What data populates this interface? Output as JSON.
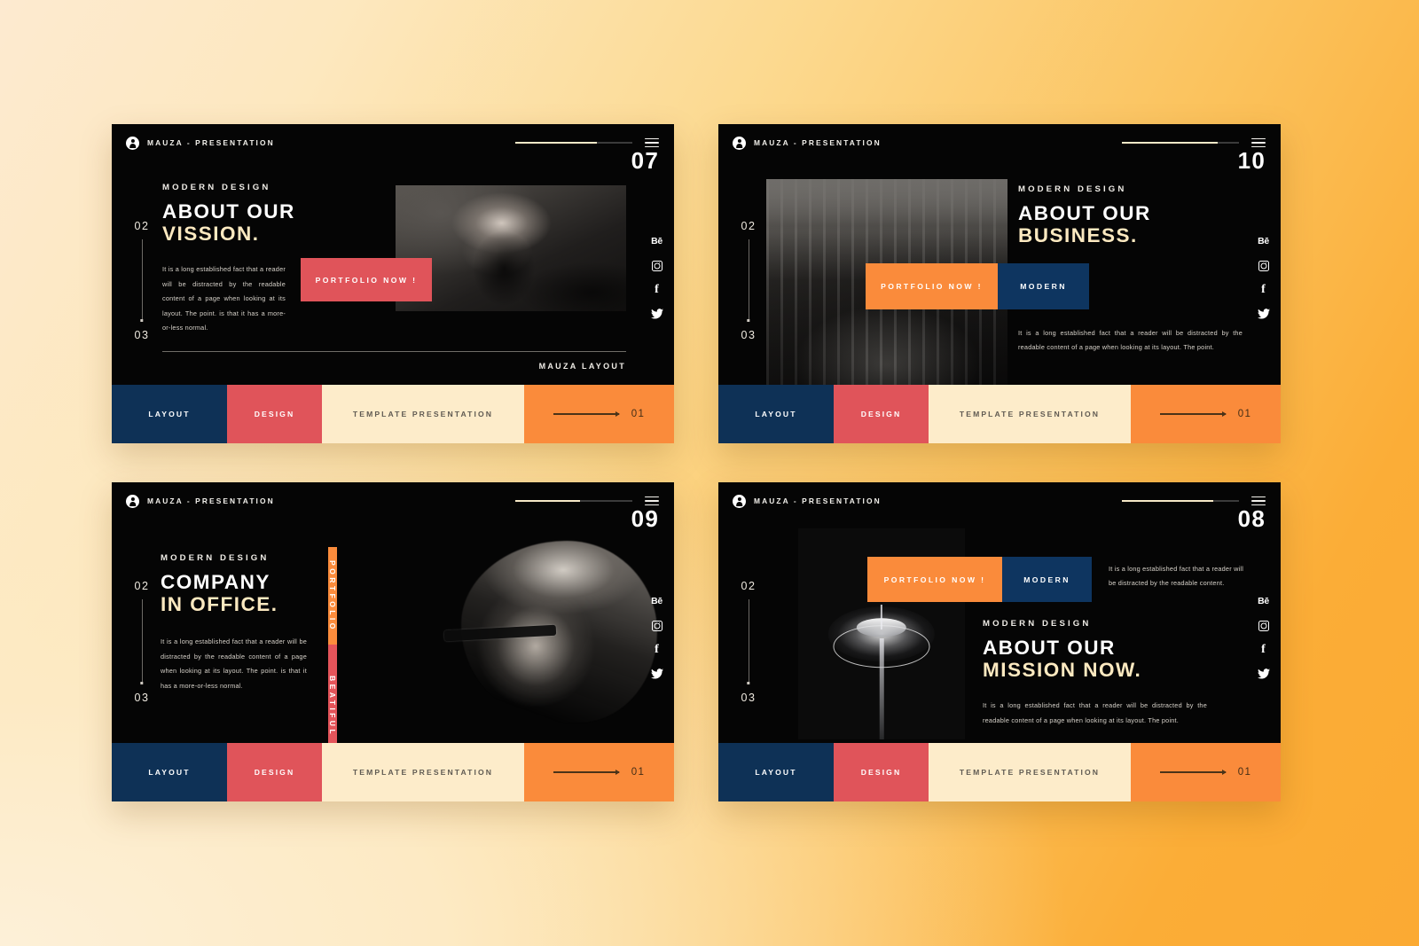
{
  "theme": {
    "navy": "#0e3156",
    "red": "#e0545a",
    "orange": "#fa8b3b",
    "cream": "#fdecca",
    "slide_bg": "#050505",
    "headline_cream": "#fce9c0",
    "page_bg_from": "#fdead0",
    "page_bg_to": "#fbaa33"
  },
  "common": {
    "brand": "MAUZA - PRESENTATION",
    "logo_icon": "user-circle-icon",
    "menu_icon": "hamburger-icon",
    "eyebrow": "MODERN DESIGN",
    "step_from": "02",
    "step_to": "03",
    "social": [
      {
        "icon": "behance-icon",
        "label": "Bē"
      },
      {
        "icon": "instagram-icon",
        "label": ""
      },
      {
        "icon": "facebook-icon",
        "label": "f"
      },
      {
        "icon": "twitter-icon",
        "label": ""
      }
    ],
    "footer": {
      "layout": "LAYOUT",
      "design": "DESIGN",
      "template": "TEMPLATE PRESENTATION",
      "arrow_icon": "arrow-right-icon",
      "number": "01"
    }
  },
  "slides": [
    {
      "id": "slide-07",
      "number": "07",
      "progress_percent": 70,
      "headline_line1": "ABOUT OUR",
      "headline_line2": "VISSION.",
      "body": "It is a long established fact that a reader will be distracted by the readable content of a page when looking at its layout. The point. is that it has a more-or-less normal.",
      "cta_primary": "PORTFOLIO NOW !",
      "cta_secondary": null,
      "layout_tag": "MAUZA LAYOUT",
      "photo": "man-in-sunglasses-photo"
    },
    {
      "id": "slide-10",
      "number": "10",
      "progress_percent": 82,
      "headline_line1": "ABOUT OUR",
      "headline_line2": "BUSINESS.",
      "body": "It is a long established fact that a reader will be distracted by the readable content of a page when looking at its layout. The point.",
      "cta_primary": "PORTFOLIO NOW !",
      "cta_secondary": "MODERN",
      "layout_tag": null,
      "photo": "telephone-boxes-street-photo"
    },
    {
      "id": "slide-09",
      "number": "09",
      "progress_percent": 55,
      "headline_line1": "COMPANY",
      "headline_line2": "IN OFFICE.",
      "body": "It is a long established fact that a reader will be distracted by the readable content of a page when looking at its layout. The point. is that it has a more-or-less normal.",
      "vertical_tab_top": "PORTFOLIO",
      "vertical_tab_bottom": "BEATIFUL",
      "layout_tag": null,
      "photo": "man-profile-glasses-photo"
    },
    {
      "id": "slide-08",
      "number": "08",
      "progress_percent": 78,
      "headline_line1": "ABOUT OUR",
      "headline_line2": "MISSION NOW.",
      "body_top": "It is a long established fact that a reader will be distracted by the readable content.",
      "body": "It is a long established fact that a reader will be distracted by the readable content of a page when looking at its layout. The point.",
      "cta_primary": "PORTFOLIO NOW !",
      "cta_secondary": "MODERN",
      "layout_tag": null,
      "photo": "street-lamp-photo"
    }
  ]
}
